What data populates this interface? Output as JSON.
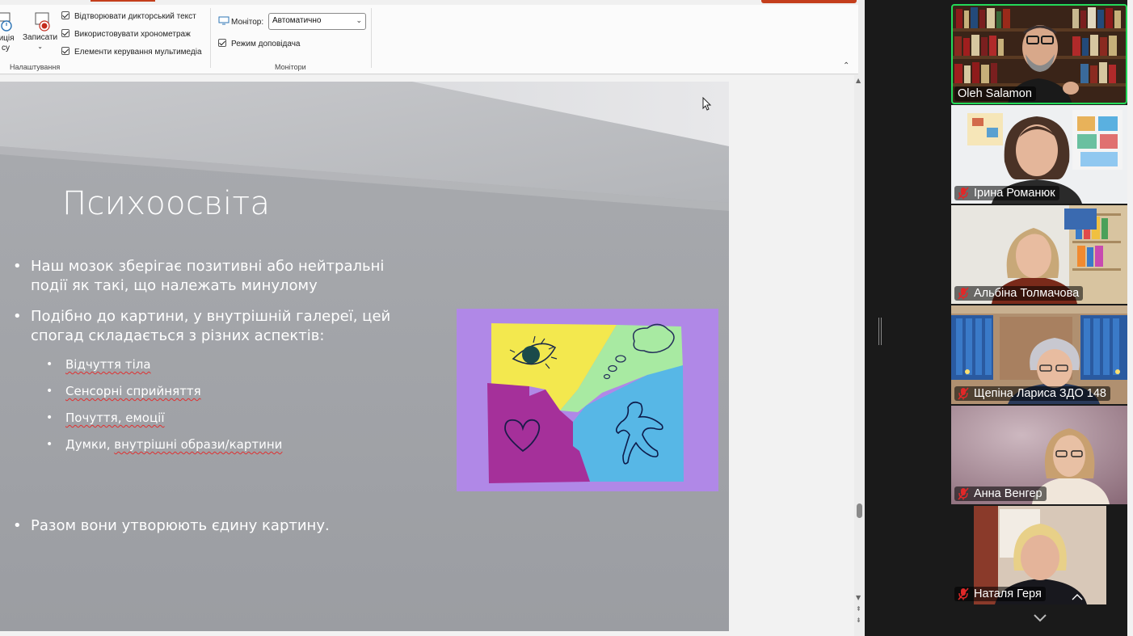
{
  "ribbon": {
    "partial_btn1": "тиція",
    "partial_btn1_line2": "су",
    "record_label": "Записати",
    "checkboxes": [
      {
        "label": "Відтворювати дикторський текст",
        "checked": true
      },
      {
        "label": "Використовувати хронометраж",
        "checked": true
      },
      {
        "label": "Елементи керування мультимедіа",
        "checked": true
      }
    ],
    "group_settings": "Налаштування",
    "monitor_label": "Монітор:",
    "monitor_value": "Автоматично",
    "presenter_view_label": "Режим доповідача",
    "presenter_view_checked": true,
    "group_monitors": "Монітори"
  },
  "slide": {
    "title": "Психоосвіта",
    "bullets": [
      {
        "line1": "Наш мозок зберігає позитивні або нейтральні",
        "line2": "події як такі, що належать минулому"
      },
      {
        "line1": "Подібно до картини, у внутрішній галереї, цей",
        "line2": "спогад складається з різних аспектів:"
      }
    ],
    "subbullets": [
      {
        "pre": "",
        "squiggle": "Відчуття тіла"
      },
      {
        "pre": "",
        "squiggle": "Сенсорні сприйняття"
      },
      {
        "pre": "",
        "squiggle": "Почуття, емоції"
      },
      {
        "pre": "Думки, ",
        "squiggle": "внутрішні образи/картини"
      }
    ],
    "bullet_last": "Разом вони утворюють єдину картину."
  },
  "participants": [
    {
      "name": "Oleh Salamon",
      "muted": false,
      "active": true
    },
    {
      "name": "Ірина Романюк",
      "muted": true,
      "active": false
    },
    {
      "name": "Альбіна Толмачова",
      "muted": true,
      "active": false
    },
    {
      "name": "Щепіна Лариса ЗДО 148",
      "muted": true,
      "active": false
    },
    {
      "name": "Анна Венгер",
      "muted": true,
      "active": false
    },
    {
      "name": "Наталя Геря",
      "muted": true,
      "active": false
    }
  ],
  "colors": {
    "active_speaker_border": "#23d959",
    "muted_icon": "#e02828",
    "accent_red": "#c43e1c"
  },
  "icons": [
    "stopwatch-icon",
    "record-icon",
    "monitor-icon",
    "mic-muted-icon",
    "chevron-down-icon",
    "collapse-ribbon-icon",
    "mouse-cursor-icon"
  ]
}
